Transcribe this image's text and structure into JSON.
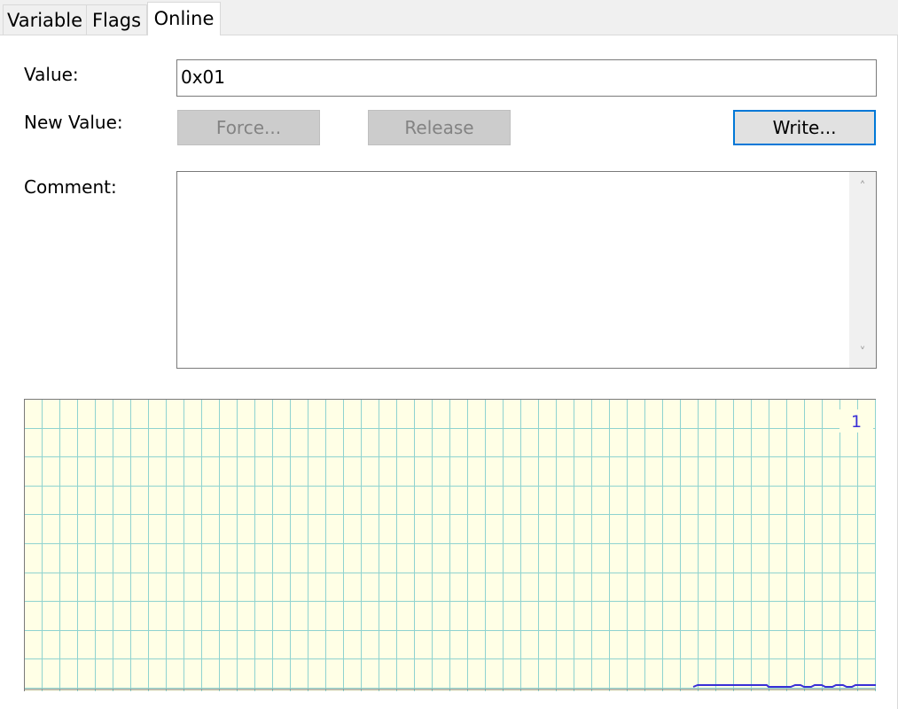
{
  "tabs": [
    {
      "label": "Variable",
      "active": false
    },
    {
      "label": "Flags",
      "active": false
    },
    {
      "label": "Online",
      "active": true
    }
  ],
  "value": {
    "label": "Value:",
    "field": "0x01"
  },
  "new_value": {
    "label": "New Value:",
    "force_label": "Force...",
    "release_label": "Release",
    "write_label": "Write..."
  },
  "comment": {
    "label": "Comment:",
    "text": ""
  },
  "trend": {
    "scale_label": "1",
    "background": "#ffffe6",
    "grid_color": "#8fd3d0",
    "trace_color": "#3a2fd6",
    "trace_level": 0.0
  }
}
